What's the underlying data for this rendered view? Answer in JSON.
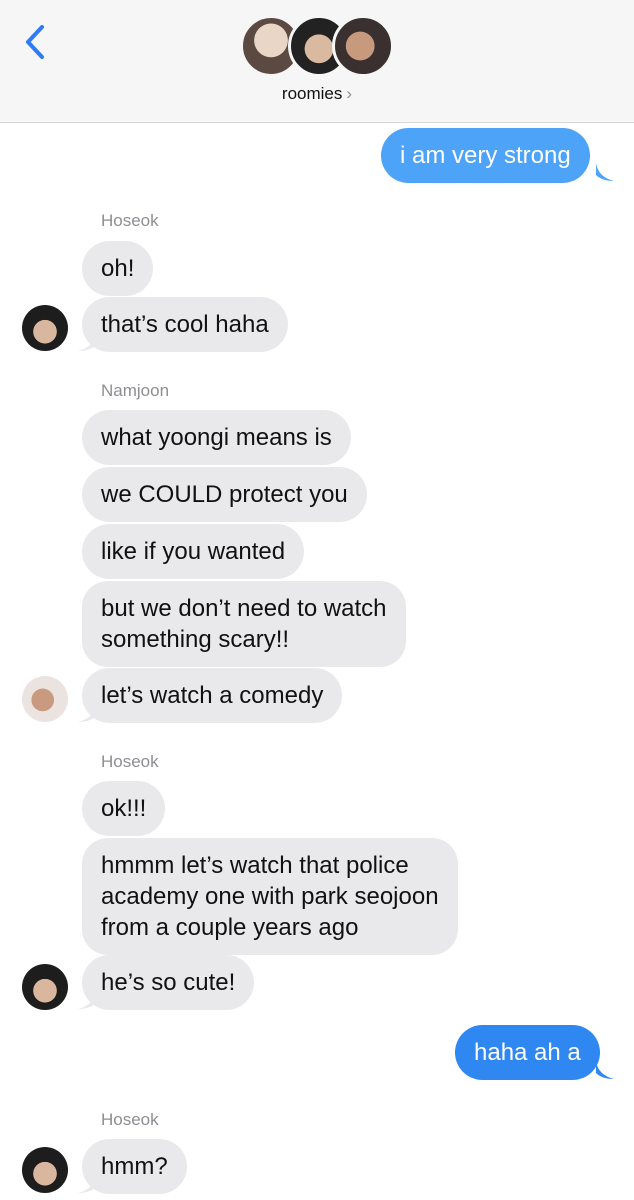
{
  "header": {
    "group_name": "roomies",
    "chevron": "›",
    "back_icon": "chevron-left-icon",
    "accent": "#2f7bf5"
  },
  "messages": [
    {
      "dir": "out",
      "text": "i am very strong"
    },
    {
      "dir": "in",
      "sender": "Hoseok",
      "text": "oh!"
    },
    {
      "dir": "in",
      "text": "that’s cool haha"
    },
    {
      "dir": "in",
      "sender": "Namjoon",
      "text": "what yoongi means is"
    },
    {
      "dir": "in",
      "text": "we COULD protect you"
    },
    {
      "dir": "in",
      "text": "like if you wanted"
    },
    {
      "dir": "in",
      "text": "but we don’t need to watch",
      "text2": "something scary!!"
    },
    {
      "dir": "in",
      "text": "let’s watch a comedy"
    },
    {
      "dir": "in",
      "sender": "Hoseok",
      "text": "ok!!!"
    },
    {
      "dir": "in",
      "text": "hmmm let’s watch that police",
      "text2": "academy one with park seojoon",
      "text3": "from a couple years ago"
    },
    {
      "dir": "in",
      "text": "he’s so cute!"
    },
    {
      "dir": "out",
      "text": "haha ah a"
    },
    {
      "dir": "in",
      "sender": "Hoseok",
      "text": "hmm?"
    }
  ],
  "colors": {
    "incoming_bubble": "#e9e9eb",
    "outgoing_bubble": "#4da3f7",
    "outgoing_bubble_latest": "#2f87f2",
    "sender_name": "#8e8e93"
  }
}
